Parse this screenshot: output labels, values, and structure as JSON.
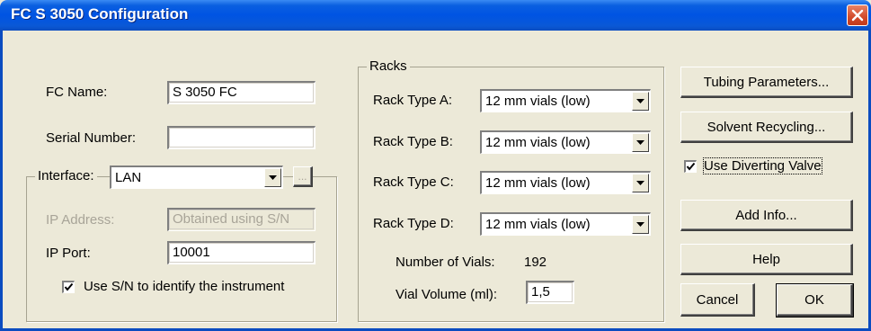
{
  "window": {
    "title": "FC S 3050 Configuration"
  },
  "general": {
    "fc_name_label": "FC Name:",
    "fc_name_value": "S 3050 FC",
    "serial_label": "Serial Number:",
    "serial_value": ""
  },
  "interface": {
    "label": "Interface:",
    "selected": "LAN",
    "browse_label": "...",
    "ip_address_label": "IP Address:",
    "ip_address_value": "Obtained using S/N",
    "ip_port_label": "IP Port:",
    "ip_port_value": "10001",
    "use_sn_label": "Use S/N to identify the instrument",
    "use_sn_checked": true
  },
  "racks": {
    "legend": "Racks",
    "items": [
      {
        "label": "Rack Type A:",
        "value": "12 mm vials (low)"
      },
      {
        "label": "Rack Type B:",
        "value": "12 mm vials (low)"
      },
      {
        "label": "Rack Type C:",
        "value": "12 mm vials (low)"
      },
      {
        "label": "Rack Type D:",
        "value": "12 mm vials (low)"
      }
    ],
    "num_vials_label": "Number of Vials:",
    "num_vials_value": "192",
    "vial_volume_label": "Vial Volume (ml):",
    "vial_volume_value": "1,5"
  },
  "side": {
    "tubing_button": "Tubing Parameters...",
    "solvent_button": "Solvent Recycling...",
    "diverting_label": "Use Diverting Valve",
    "diverting_checked": true,
    "add_info_button": "Add Info...",
    "help_button": "Help",
    "cancel_button": "Cancel",
    "ok_button": "OK"
  },
  "icons": {
    "close": "close-icon",
    "dropdown": "chevron-down-icon",
    "check": "check-icon"
  },
  "colors": {
    "titlebar": "#0054e3",
    "face": "#ece9d8",
    "close": "#d24a2a"
  }
}
